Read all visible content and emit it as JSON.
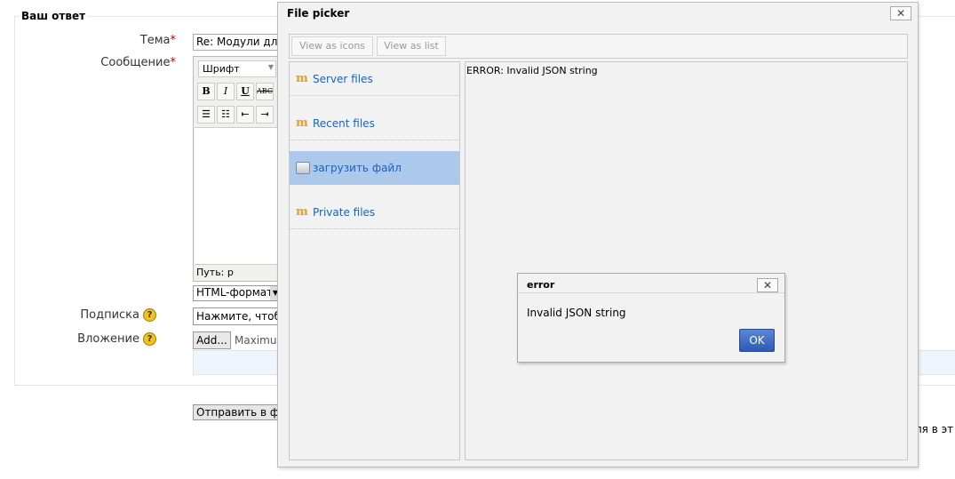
{
  "form": {
    "legend": "Ваш ответ",
    "subject_label": "Тема",
    "subject_value": "Re: Модули для",
    "message_label": "Сообщение",
    "font_select": "Шрифт",
    "toolbar_row1": [
      "B",
      "I",
      "U",
      "ABC"
    ],
    "toolbar_row2": [
      "☰",
      "☷",
      "⇤",
      "⇥"
    ],
    "path_label": "Путь: p",
    "format_value": "HTML-формат",
    "subscription_label": "Подписка",
    "subscription_value": "Нажмите, чтобы",
    "attachment_label": "Вложение",
    "add_button": "Add...",
    "max_text": "Maximu",
    "submit_button": "Отправить в фо",
    "right_text": "ля в эт"
  },
  "file_picker": {
    "title": "File picker",
    "close": "✕",
    "view_icons": "View as icons",
    "view_list": "View as list",
    "repositories": [
      {
        "label": "Server files",
        "icon": "moodle-icon",
        "selected": false
      },
      {
        "label": "Recent files",
        "icon": "moodle-icon",
        "selected": false
      },
      {
        "label": "загрузить файл",
        "icon": "upload-icon",
        "selected": true
      },
      {
        "label": "Private files",
        "icon": "moodle-icon",
        "selected": false
      }
    ],
    "error_text": "ERROR: Invalid JSON string"
  },
  "error_dialog": {
    "title": "error",
    "close": "✕",
    "message": "Invalid JSON string",
    "ok": "OK"
  },
  "colors": {
    "link": "#1a63b8",
    "selected_repo": "#acc9ec",
    "ok_button": "#2c5bb5",
    "required": "#cc0000"
  }
}
